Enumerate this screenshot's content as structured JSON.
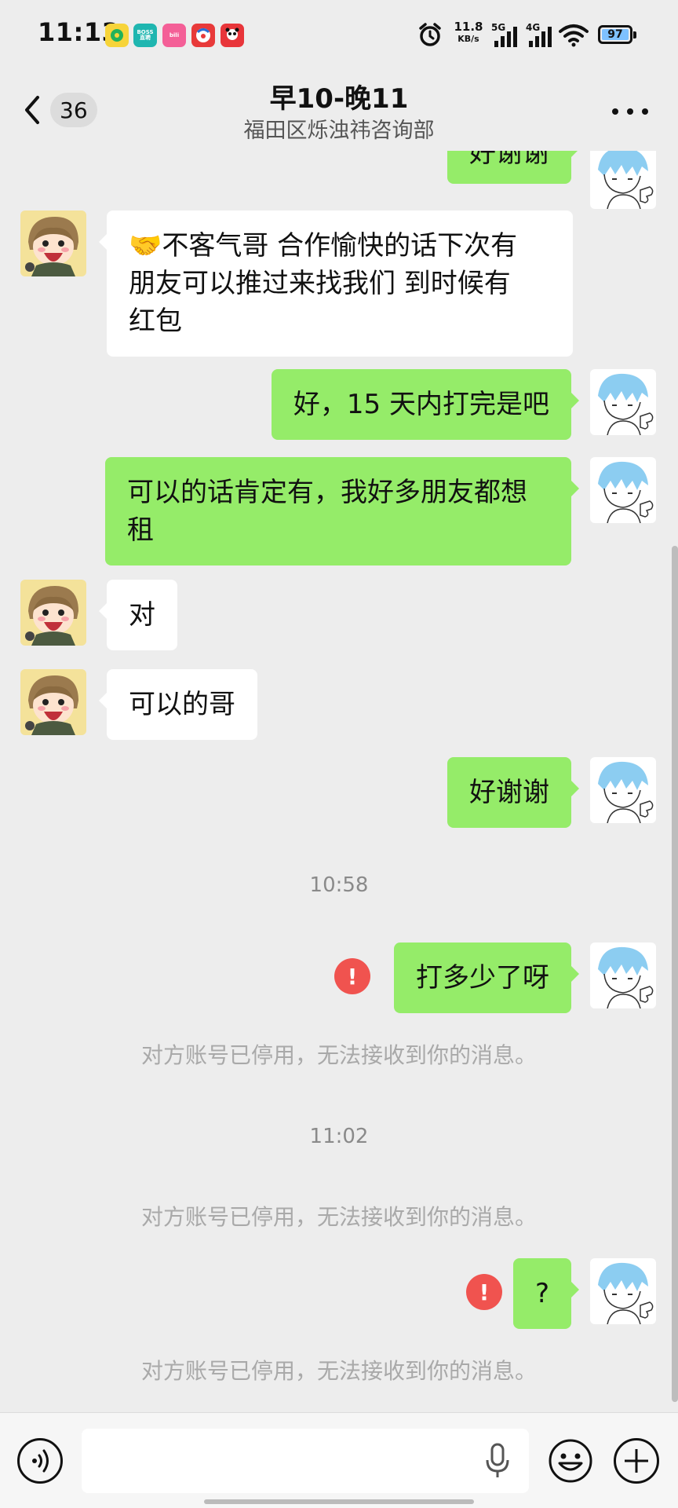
{
  "status_bar": {
    "time": "11:13",
    "apps": [
      {
        "icon": "qq-music-icon",
        "label": "",
        "color": "#f7d43a"
      },
      {
        "icon": "boss-zhipin-icon",
        "label": "BOSS 直聘",
        "color": "#1fb6b0"
      },
      {
        "icon": "bilibili-icon",
        "label": "bili",
        "color": "#f45f97"
      },
      {
        "icon": "circus-app-icon",
        "label": "",
        "color": "#e83a3a"
      },
      {
        "icon": "panda-app-icon",
        "label": "",
        "color": "#e8353a"
      }
    ],
    "net_speed_value": "11.8",
    "net_speed_unit": "KB/s",
    "signal_1": "5G",
    "signal_2": "4G",
    "battery": "97"
  },
  "header": {
    "back_count": "36",
    "title": "早10-晚11",
    "subtitle": "福田区烁浊祎咨询部"
  },
  "messages": {
    "m0": "好谢谢",
    "m1_emoji": "🤝",
    "m1_lines": [
      "不客气哥 合作愉快的话下次有",
      "朋友可以推过来找我们 到时候有",
      "红包"
    ],
    "m2": "好，15 天内打完是吧",
    "m3_lines": [
      "可以的话肯定有，我好多朋友都想",
      "租"
    ],
    "m4": "对",
    "m5": "可以的哥",
    "m6": "好谢谢",
    "t1": "10:58",
    "m7": "打多少了呀",
    "sys1": "对方账号已停用，无法接收到你的消息。",
    "t2": "11:02",
    "sys2": "对方账号已停用，无法接收到你的消息。",
    "m8": "?",
    "sys3": "对方账号已停用，无法接收到你的消息。",
    "error_mark": "!"
  },
  "input_bar": {
    "placeholder": ""
  },
  "colors": {
    "background": "#ededed",
    "incoming_bubble": "#ffffff",
    "outgoing_bubble": "#95ec69",
    "error": "#f0534f"
  }
}
